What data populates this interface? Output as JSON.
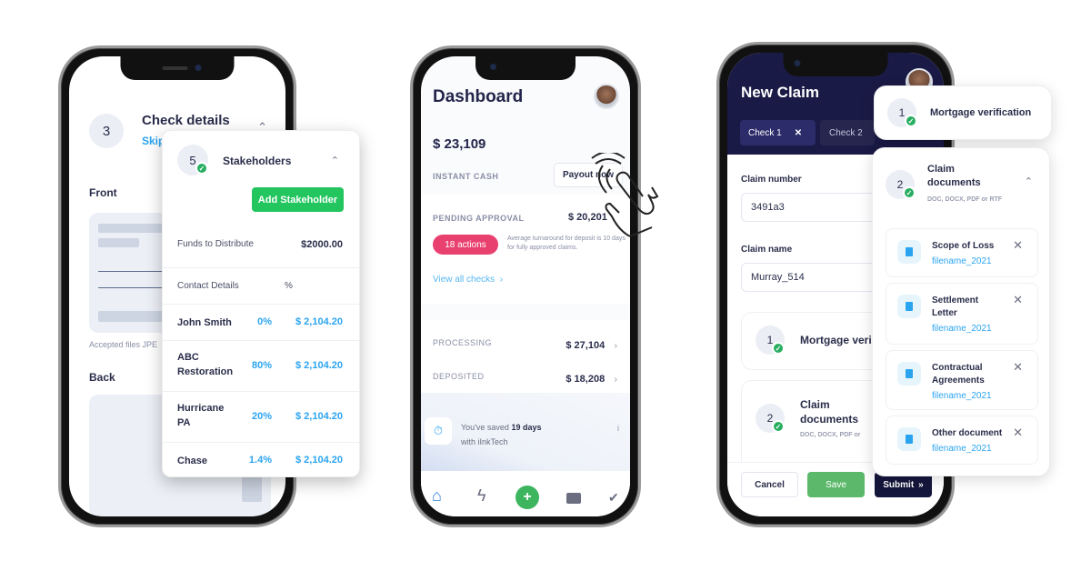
{
  "phone1": {
    "step_number": "3",
    "step_title": "Check details",
    "skip_label": "Skip",
    "front_label": "Front",
    "accepted_files": "Accepted files JPE",
    "back_label": "Back",
    "stakeholders": {
      "step_number": "5",
      "title": "Stakeholders",
      "add_button": "Add Stakeholder",
      "funds_label": "Funds to Distribute",
      "funds_value": "$2000.00",
      "col_contact": "Contact Details",
      "col_pct": "%",
      "rows": [
        {
          "name": "John Smith",
          "pct": "0%",
          "amount": "$ 2,104.20"
        },
        {
          "name": "ABC Restoration",
          "pct": "80%",
          "amount": "$ 2,104.20"
        },
        {
          "name": "Hurricane PA",
          "pct": "20%",
          "amount": "$ 2,104.20"
        },
        {
          "name": "Chase",
          "pct": "1.4%",
          "amount": "$ 2,104.20"
        }
      ]
    }
  },
  "phone2": {
    "title": "Dashboard",
    "balance": "$ 23,109",
    "instant_cash_label": "INSTANT CASH",
    "payout_button": "Payout now",
    "pending_label": "PENDING APPROVAL",
    "pending_value": "$ 20,201",
    "actions_badge": "18 actions",
    "turnaround_note": "Average turnaround for deposit is 10 days for fully approved claims.",
    "view_all": "View all checks",
    "processing_label": "PROCESSING",
    "processing_value": "$ 27,104",
    "deposited_label": "DEPOSITED",
    "deposited_value": "$ 18,208",
    "saved_prefix": "You've saved ",
    "saved_days": "19 days",
    "saved_suffix": "with iInkTech",
    "info_icon": "i",
    "nav": [
      "home-icon",
      "bolt-icon",
      "plus-icon",
      "wallet-icon",
      "double-check-icon"
    ]
  },
  "phone3": {
    "title": "New Claim",
    "tabs": [
      {
        "label": "Check 1",
        "closable": true
      },
      {
        "label": "Check 2",
        "closable": false
      }
    ],
    "claim_number_label": "Claim number",
    "claim_number_value": "3491a3",
    "claim_name_label": "Claim name",
    "claim_name_value": "Murray_514",
    "step1_number": "1",
    "step1_title": "Mortgage veri",
    "step2_number": "2",
    "step2_title": "Claim documents",
    "step2_sub": "DOC, DOCX, PDF or",
    "doc_peek": "Scope of Loss",
    "cancel": "Cancel",
    "save": "Save",
    "submit": "Submit",
    "submit_icon": "»"
  },
  "overlay": {
    "mortgage_number": "1",
    "mortgage_title": "Mortgage verification",
    "claim_number": "2",
    "claim_title": "Claim documents",
    "claim_sub": "DOC, DOCX, PDF or RTF",
    "documents": [
      {
        "title": "Scope of Loss",
        "file": "filename_2021"
      },
      {
        "title": "Settlement Letter",
        "file": "filename_2021"
      },
      {
        "title": "Contractual Agreements",
        "file": "filename_2021"
      },
      {
        "title": "Other document",
        "file": "filename_2021"
      }
    ]
  },
  "colors": {
    "green": "#22c55e",
    "blue": "#2ba4f0",
    "pink": "#e9416f",
    "navy": "#1a1a46"
  }
}
